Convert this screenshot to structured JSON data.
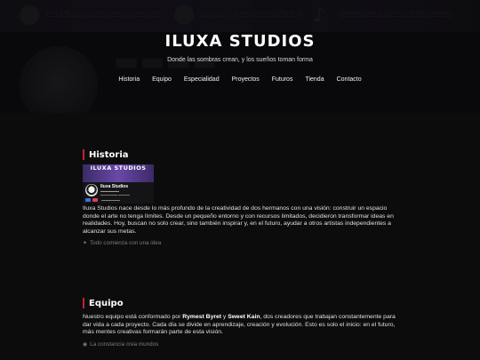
{
  "header": {
    "title": "ILUXA STUDIOS",
    "tagline": "Donde las sombras crean, y los sueños toman forma",
    "nav": [
      {
        "label": "Historia"
      },
      {
        "label": "Equipo"
      },
      {
        "label": "Especialidad"
      },
      {
        "label": "Proyectos"
      },
      {
        "label": "Futuros"
      },
      {
        "label": "Tienda"
      },
      {
        "label": "Contacto"
      }
    ]
  },
  "colors": {
    "accent": "#c81e3a",
    "background": "#0c0c0c",
    "hero": "#121214"
  },
  "historia": {
    "title": "Historia",
    "card": {
      "banner": "ILUXA STUDIOS",
      "name": "Iluxa Studios"
    },
    "text": "Iluxa Studios nace desde lo más profundo de la creatividad de dos hermanos con una visión: construir un espacio donde el arte no tenga límites. Desde un pequeño entorno y con recursos limitados, decidieron transformar ideas en realidades. Hoy, buscan no solo crear, sino también inspirar y, en el futuro, ayudar a otros artistas independientes a alcanzar sus metas.",
    "note": "Todo comienza con una idea",
    "note_icon": "sparkle-icon"
  },
  "equipo": {
    "title": "Equipo",
    "text_before": "Nuestro equipo está conformado por ",
    "member1": "Rymest Byret",
    "text_and": " y ",
    "member2": "Sweet Kain",
    "text_after": ", dos creadores que trabajan constantemente para dar vida a cada proyecto. Cada día se divide en aprendizaje, creación y evolución. Esto es solo el inicio: en el futuro, más mentes creativas formarán parte de esta visión.",
    "note": "La constancia crea mundos",
    "note_icon": "circle-icon"
  }
}
